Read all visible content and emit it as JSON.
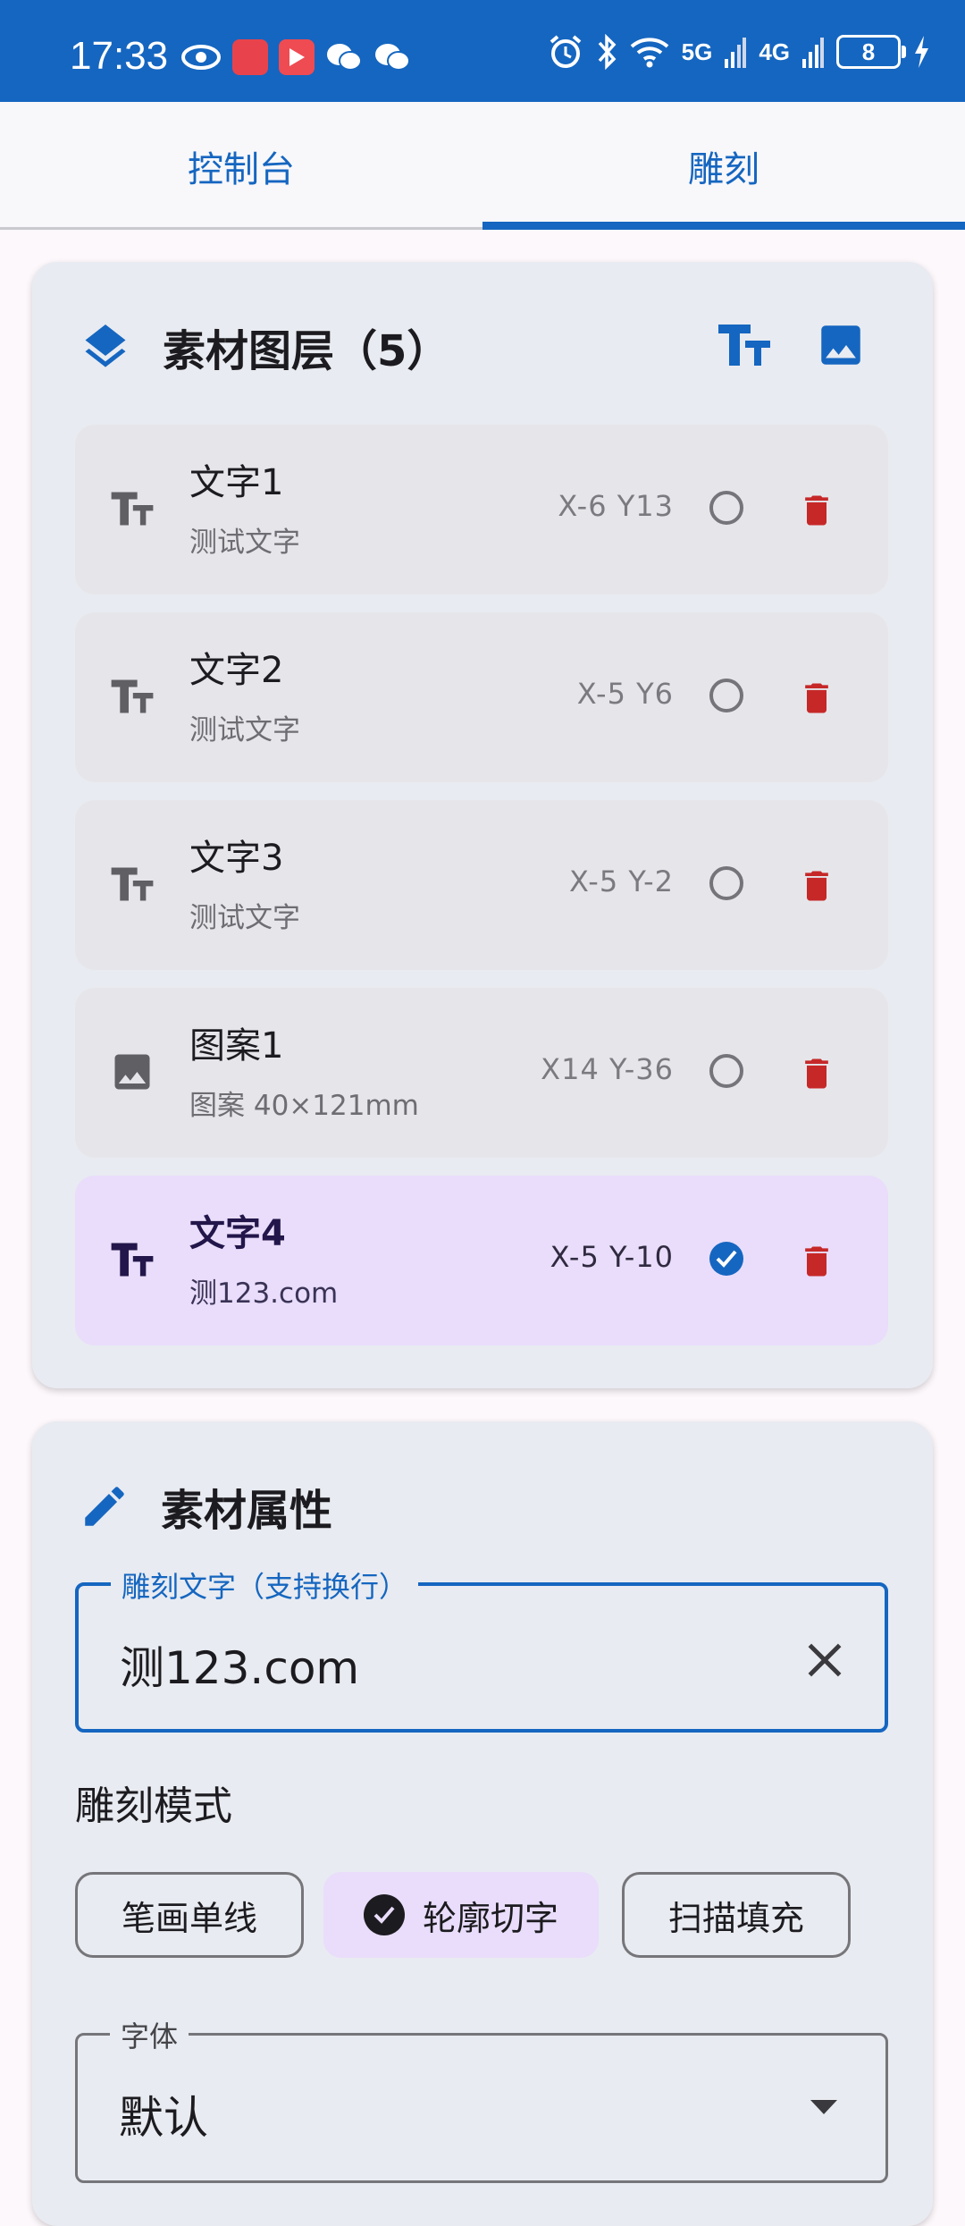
{
  "status_bar": {
    "time": "17:33",
    "network_1": "5G",
    "network_2": "4G",
    "battery": "8"
  },
  "tabs": [
    {
      "label": "控制台",
      "selected": false
    },
    {
      "label": "雕刻",
      "selected": true
    }
  ],
  "layers_card": {
    "title": "素材图层（5）",
    "items": [
      {
        "name": "文字1",
        "sub": "测试文字",
        "coords": "X-6 Y13",
        "type": "text",
        "selected": false
      },
      {
        "name": "文字2",
        "sub": "测试文字",
        "coords": "X-5 Y6",
        "type": "text",
        "selected": false
      },
      {
        "name": "文字3",
        "sub": "测试文字",
        "coords": "X-5 Y-2",
        "type": "text",
        "selected": false
      },
      {
        "name": "图案1",
        "sub": "图案 40×121mm",
        "coords": "X14 Y-36",
        "type": "image",
        "selected": false
      },
      {
        "name": "文字4",
        "sub": "测123.com",
        "coords": "X-5 Y-10",
        "type": "text",
        "selected": true
      }
    ]
  },
  "props_card": {
    "title": "素材属性",
    "text_field": {
      "label": "雕刻文字（支持换行）",
      "value": "测123.com"
    },
    "mode_label": "雕刻模式",
    "modes": [
      {
        "label": "笔画单线",
        "selected": false
      },
      {
        "label": "轮廓切字",
        "selected": true
      },
      {
        "label": "扫描填充",
        "selected": false
      }
    ],
    "font_field": {
      "label": "字体",
      "value": "默认"
    }
  },
  "colors": {
    "primary": "#1566c0",
    "danger": "#c62828",
    "selected_bg": "#e9ddfb",
    "card_bg": "#e8ebf1"
  }
}
